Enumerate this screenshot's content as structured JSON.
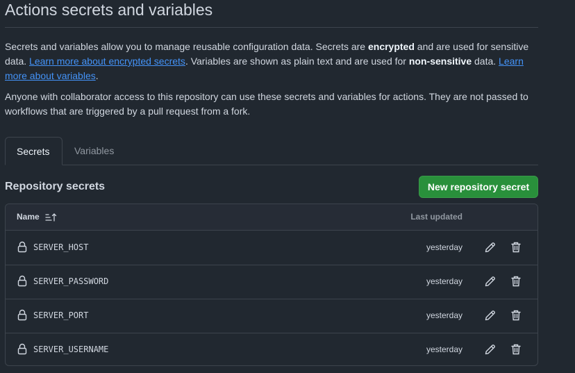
{
  "page": {
    "title": "Actions secrets and variables"
  },
  "description": {
    "p1_a": "Secrets and variables allow you to manage reusable configuration data. Secrets are ",
    "p1_b": "encrypted",
    "p1_c": " and are used for sensitive data. ",
    "p1_link1": "Learn more about encrypted secrets",
    "p1_d": ". Variables are shown as plain text and are used for ",
    "p1_e": "non-sensitive",
    "p1_f": " data. ",
    "p1_link2": "Learn more about variables",
    "p1_g": ".",
    "p2": "Anyone with collaborator access to this repository can use these secrets and variables for actions. They are not passed to workflows that are triggered by a pull request from a fork."
  },
  "tabs": [
    {
      "label": "Secrets",
      "selected": true
    },
    {
      "label": "Variables",
      "selected": false
    }
  ],
  "section": {
    "title": "Repository secrets",
    "new_button": "New repository secret"
  },
  "table": {
    "headers": {
      "name": "Name",
      "sort_icon": "sort-ascending-icon",
      "last_updated": "Last updated"
    },
    "rows": [
      {
        "name": "SERVER_HOST",
        "updated": "yesterday"
      },
      {
        "name": "SERVER_PASSWORD",
        "updated": "yesterday"
      },
      {
        "name": "SERVER_PORT",
        "updated": "yesterday"
      },
      {
        "name": "SERVER_USERNAME",
        "updated": "yesterday"
      }
    ]
  },
  "icons": {
    "lock": "lock-icon",
    "edit": "pencil-icon",
    "delete": "trash-icon"
  },
  "colors": {
    "background": "#212830",
    "accent_link": "#4493f8",
    "primary_button": "#29903b",
    "border": "#3d444d"
  }
}
